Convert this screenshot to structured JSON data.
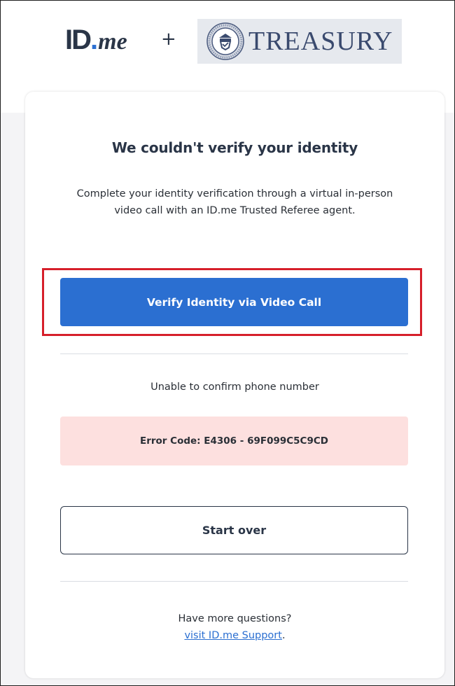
{
  "header": {
    "idme_logo": {
      "id": "ID",
      "dot": ".",
      "me": "me"
    },
    "plus": "+",
    "partner_logo": {
      "name": "TREASURY",
      "seal_icon": "treasury-seal"
    }
  },
  "card": {
    "heading": "We couldn't verify your identity",
    "description": "Complete your identity verification through a virtual in-person video call with an ID.me Trusted Referee agent.",
    "primary_button": "Verify Identity via Video Call",
    "status_text": "Unable to confirm phone number",
    "error_code": "Error Code: E4306 - 69F099C5C9CD",
    "secondary_button": "Start over",
    "help_text": "Have more questions?",
    "support_link": "visit ID.me Support",
    "support_suffix": "."
  },
  "colors": {
    "primary": "#2b6fd1",
    "error_bg": "#fde0df",
    "highlight": "#d61f2a",
    "text_dark": "#2a3547"
  }
}
